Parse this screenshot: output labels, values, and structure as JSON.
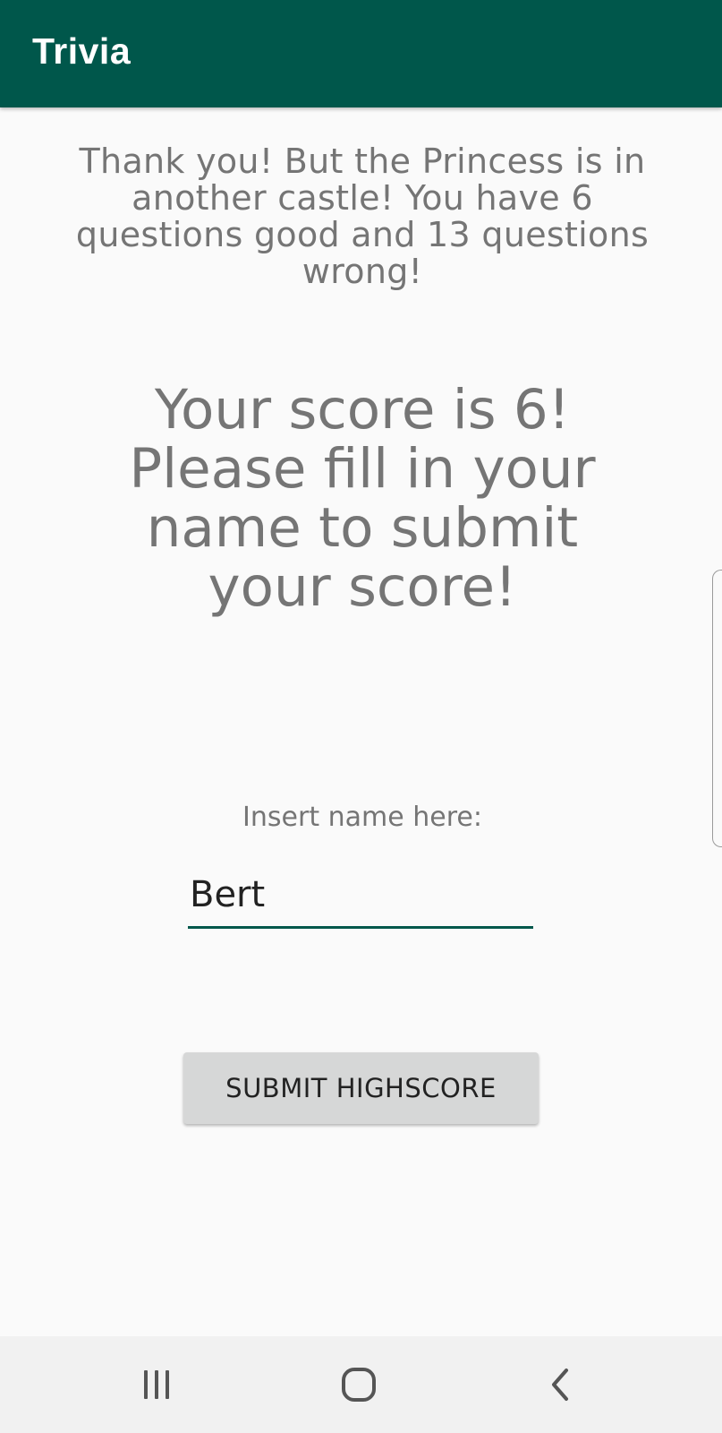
{
  "app_bar": {
    "title": "Trivia",
    "color": "#00574b"
  },
  "result": {
    "message": "Thank you! But the Princess is in another castle! You have 6 questions good and 13 questions wrong!",
    "correct_count": 6,
    "wrong_count": 13
  },
  "score": {
    "message": "Your score is 6! Please fill in your name to submit your score!",
    "value": 6
  },
  "name_form": {
    "label": "Insert name here:",
    "value": "Bert",
    "underline_color": "#00574b"
  },
  "submit": {
    "label": "SUBMIT HIGHSCORE"
  },
  "navigation": {
    "icons": [
      "recents-icon",
      "home-icon",
      "back-icon"
    ]
  }
}
